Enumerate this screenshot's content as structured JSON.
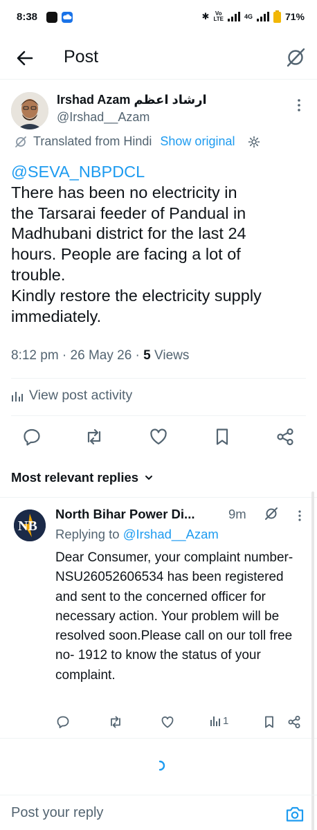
{
  "status_bar": {
    "time": "8:38",
    "network_label_top": "Vo",
    "network_label_bottom": "LTE",
    "network_type": "4G",
    "battery": "71%"
  },
  "header": {
    "title": "Post",
    "back_icon": "arrow-left-icon",
    "grok_icon": "grok-slash-icon"
  },
  "post": {
    "author_name": "Irshad Azam ارشاد اعظم",
    "author_handle": "@Irshad__Azam",
    "translated_label": "Translated from Hindi",
    "show_original_label": "Show original",
    "mention": "@SEVA_NBPDCL",
    "body": "There has been no electricity in\nthe Tarsarai feeder of Pandual in\nMadhubani district for the last 24\nhours. People are facing a lot of\ntrouble.\nKindly restore the electricity supply\nimmediately.",
    "time": "8:12 pm",
    "date": "26 May 26",
    "views_count": "5",
    "views_label": "Views",
    "activity_label": "View post activity"
  },
  "replies_section": {
    "sort_label": "Most relevant replies"
  },
  "reply": {
    "author_name": "North Bihar Power Di...",
    "time": "9m",
    "replying_to_label": "Replying to",
    "replying_to_handle": "@Irshad__Azam",
    "body": "Dear Consumer, your complaint number- NSU26052606534 has been registered and sent to the concerned officer for necessary action. Your problem will be resolved soon.Please call on our toll free no- 1912 to know the status of your complaint.",
    "views": "1",
    "avatar_letters": "NB"
  },
  "compose": {
    "placeholder": "Post your reply"
  },
  "colors": {
    "accent": "#1d9bf0",
    "text": "#0f1419",
    "secondary": "#536471"
  }
}
